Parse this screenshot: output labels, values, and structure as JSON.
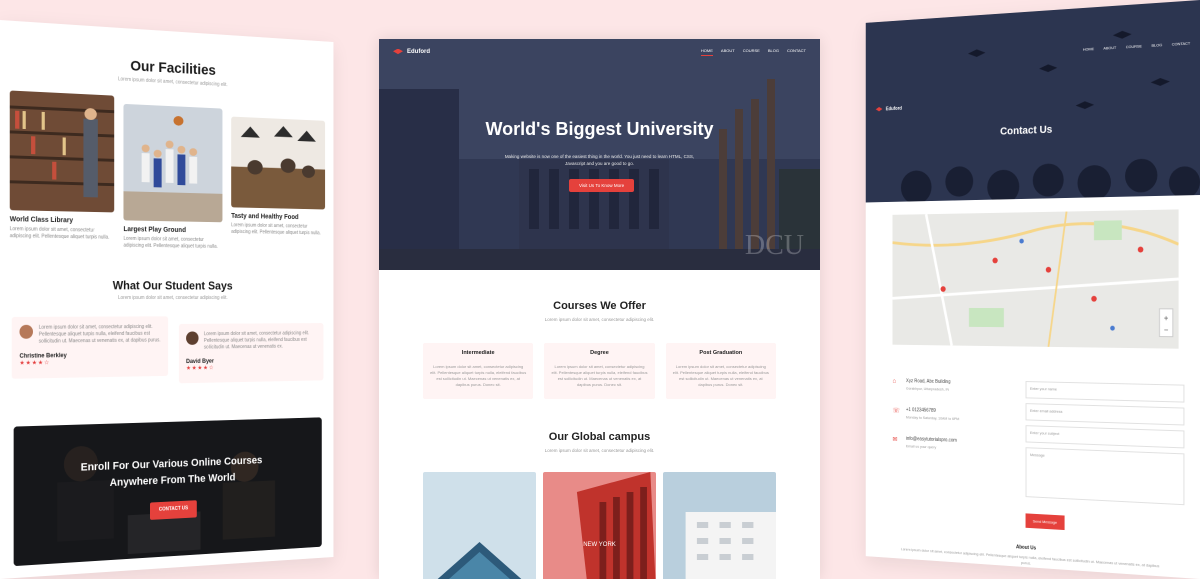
{
  "colors": {
    "accent": "#e5413c",
    "background": "#fde6e7",
    "hero": "#2c3349"
  },
  "left": {
    "facilities_title": "Our Facilities",
    "facilities_subtitle": "Lorem ipsum dolor sit amet, consectetur adipiscing elit.",
    "facilities": [
      {
        "name": "World Class Library",
        "desc": "Lorem ipsum dolor sit amet, consectetur adipiscing elit. Pellentesque aliquet turpis nulla."
      },
      {
        "name": "Largest Play Ground",
        "desc": "Lorem ipsum dolor sit amet, consectetur adipiscing elit. Pellentesque aliquet turpis nulla."
      },
      {
        "name": "Tasty and Healthy Food",
        "desc": "Lorem ipsum dolor sit amet, consectetur adipiscing elit. Pellentesque aliquet turpis nulla."
      }
    ],
    "testimonial_title": "What Our Student Says",
    "testimonial_subtitle": "Lorem ipsum dolor sit amet, consectetur adipiscing elit.",
    "testimonials": [
      {
        "text": "Lorem ipsum dolor sit amet, consectetur adipiscing elit. Pellentesque aliquet turpis nulla, eleifend faucibus est sollicitudin ut. Maecenas ut venenatis ex, at dapibus purus.",
        "name": "Christine Berkley",
        "stars": "★★★★☆"
      },
      {
        "text": "Lorem ipsum dolor sit amet, consectetur adipiscing elit. Pellentesque aliquet turpis nulla, eleifend faucibus est sollicitudin ut. Maecenas ut venenatis ex.",
        "name": "David Byer",
        "stars": "★★★★☆"
      }
    ],
    "enroll_line1": "Enroll For Our Various Online Courses",
    "enroll_line2": "Anywhere From The World",
    "enroll_button": "CONTACT US"
  },
  "center": {
    "logo": "Eduford",
    "nav": [
      "HOME",
      "ABOUT",
      "COURSE",
      "BLOG",
      "CONTACT"
    ],
    "hero_title": "World's Biggest University",
    "hero_subtitle": "Making website is now one of the easiest thing in the world. You just need to learn HTML, CSS, Javascript and you are good to go.",
    "hero_button": "Visit Us To Know More",
    "watermark": "DCU",
    "courses_title": "Courses We Offer",
    "courses_subtitle": "Lorem ipsum dolor sit amet, consectetur adipiscing elit.",
    "courses": [
      {
        "name": "Intermediate",
        "desc": "Lorem ipsum dolor sit amet, consectetur adipiscing elit. Pellentesque aliquet turpis nulla, eleifend faucibus est sollicitudin ut. Maecenas ut venenatis ex, at dapibus purus. Donec sit."
      },
      {
        "name": "Degree",
        "desc": "Lorem ipsum dolor sit amet, consectetur adipiscing elit. Pellentesque aliquet turpis nulla, eleifend faucibus est sollicitudin ut. Maecenas ut venenatis ex, at dapibus purus. Donec sit."
      },
      {
        "name": "Post Graduation",
        "desc": "Lorem ipsum dolor sit amet, consectetur adipiscing elit. Pellentesque aliquet turpis nulla, eleifend faucibus est sollicitudin ut. Maecenas ut venenatis ex, at dapibus purus. Donec sit."
      }
    ],
    "campus_title": "Our Global campus",
    "campus_subtitle": "Lorem ipsum dolor sit amet, consectetur adipiscing elit.",
    "campus_label": "NEW YORK"
  },
  "right": {
    "logo": "Eduford",
    "nav": [
      "HOME",
      "ABOUT",
      "COURSE",
      "BLOG",
      "CONTACT"
    ],
    "title": "Contact Us",
    "contact": [
      {
        "icon": "home-icon",
        "line1": "Xyz Road, Abc Building",
        "line2": "Gorakhpur, Uttarpradesh, IN"
      },
      {
        "icon": "phone-icon",
        "line1": "+1 0123456789",
        "line2": "Monday to Saturday, 10AM to 6PM"
      },
      {
        "icon": "mail-icon",
        "line1": "info@easytutorialspro.com",
        "line2": "Email us your query"
      }
    ],
    "form": {
      "name": "Enter your name",
      "email": "Enter email address",
      "subject": "Enter your subject",
      "message": "Message",
      "send": "Send Message"
    },
    "about_title": "About Us",
    "about_desc": "Lorem ipsum dolor sit amet, consectetur adipiscing elit. Pellentesque aliquet turpis nulla, eleifend faucibus est sollicitudin ut. Maecenas ut venenatis ex, at dapibus purus."
  }
}
